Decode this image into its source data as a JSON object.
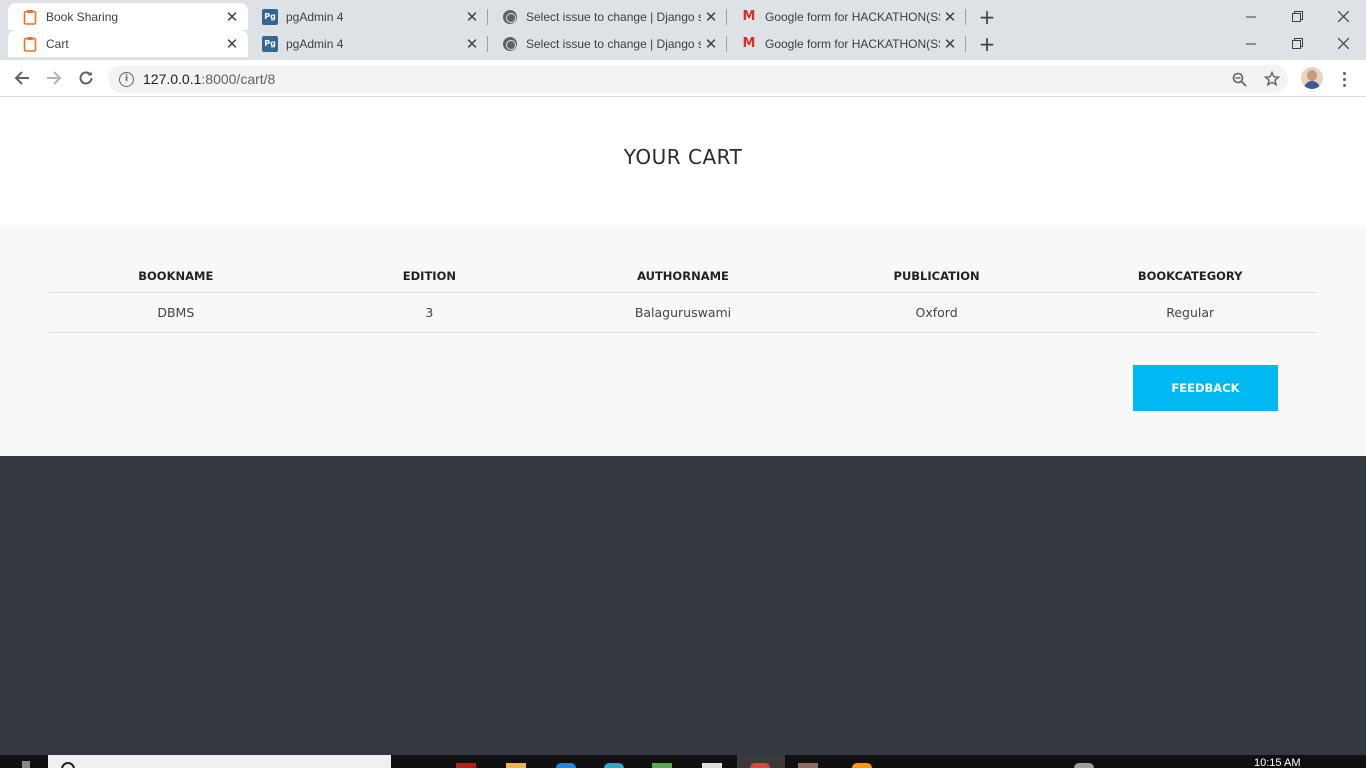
{
  "browser": {
    "tab_rows": [
      {
        "tabs": [
          {
            "title": "Book Sharing",
            "icon": "clipboard-icon",
            "active": true
          },
          {
            "title": "pgAdmin 4",
            "icon": "pgadmin-icon",
            "active": false
          },
          {
            "title": "Select issue to change | Django s",
            "icon": "globe-icon",
            "active": false
          },
          {
            "title": "Google form for HACKATHON(SS",
            "icon": "gmail-icon",
            "active": false
          }
        ]
      },
      {
        "tabs": [
          {
            "title": "Cart",
            "icon": "clipboard-icon",
            "active": true
          },
          {
            "title": "pgAdmin 4",
            "icon": "pgadmin-icon",
            "active": false
          },
          {
            "title": "Select issue to change | Django s",
            "icon": "globe-icon",
            "active": false
          },
          {
            "title": "Google form for HACKATHON(SS",
            "icon": "gmail-icon",
            "active": false
          }
        ]
      }
    ],
    "tab_close_glyph": "✕",
    "new_tab_glyph": "+",
    "pg_icon_text": "Pg",
    "gmail_icon_text": "M",
    "url_host": "127.0.0.1",
    "url_path": ":8000/cart/8"
  },
  "page": {
    "title": "YOUR CART",
    "table": {
      "headers": [
        "BOOKNAME",
        "EDITION",
        "AUTHORNAME",
        "PUBLICATION",
        "BOOKCATEGORY"
      ],
      "rows": [
        [
          "DBMS",
          "3",
          "Balaguruswami",
          "Oxford",
          "Regular"
        ]
      ]
    },
    "feedback_label": "FEEDBACK"
  },
  "colors": {
    "accent": "#00b9f2",
    "footer_bg": "#343841",
    "section_bg": "#f8f8f8"
  },
  "taskbar": {
    "clock": "10:15 AM"
  }
}
